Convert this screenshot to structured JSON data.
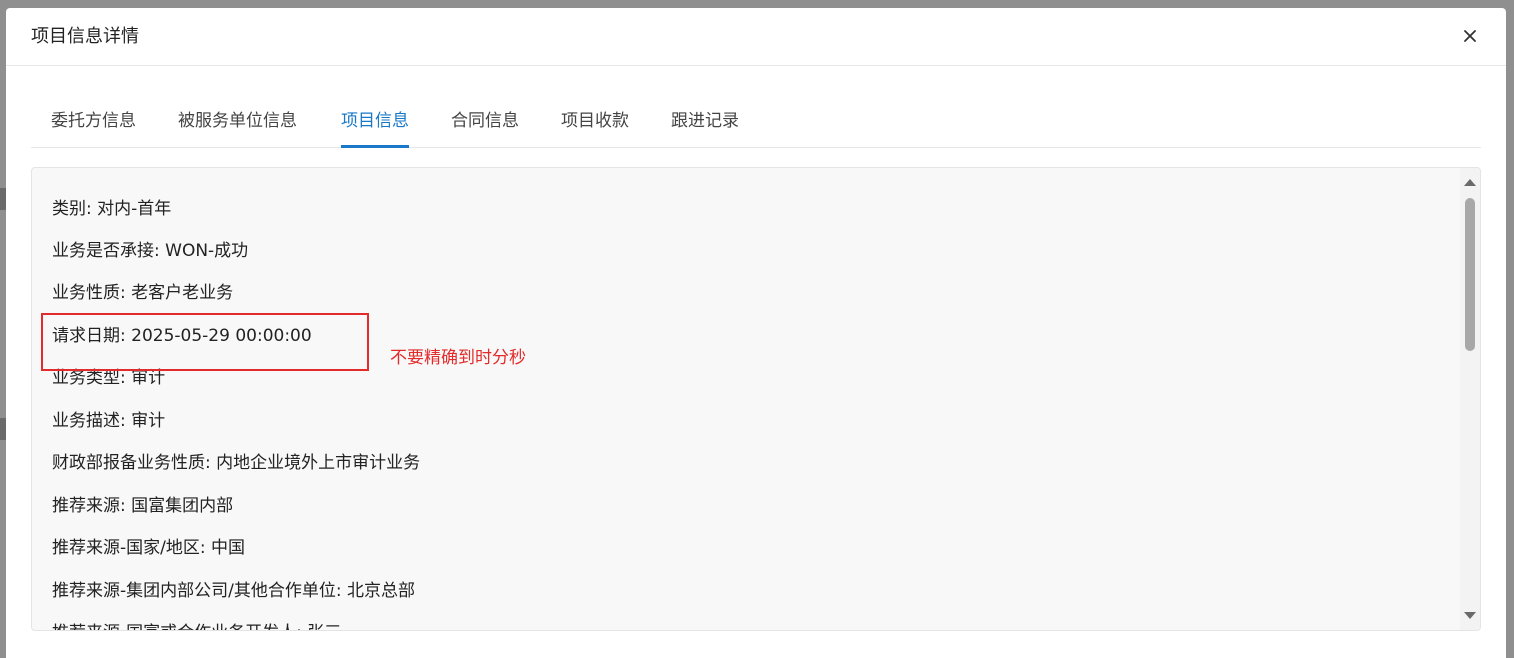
{
  "modal": {
    "title": "项目信息详情",
    "close_label": "×"
  },
  "tabs": [
    {
      "label": "委托方信息",
      "active": false
    },
    {
      "label": "被服务单位信息",
      "active": false
    },
    {
      "label": "项目信息",
      "active": true
    },
    {
      "label": "合同信息",
      "active": false
    },
    {
      "label": "项目收款",
      "active": false
    },
    {
      "label": "跟进记录",
      "active": false
    }
  ],
  "fields": [
    {
      "text": "类别: 对内-首年"
    },
    {
      "text": "业务是否承接: WON-成功"
    },
    {
      "text": "业务性质: 老客户老业务"
    },
    {
      "text": "请求日期: 2025-05-29 00:00:00"
    },
    {
      "text": "业务类型: 审计"
    },
    {
      "text": "业务描述: 审计"
    },
    {
      "text": "财政部报备业务性质: 内地企业境外上市审计业务"
    },
    {
      "text": "推荐来源: 国富集团内部"
    },
    {
      "text": "推荐来源-国家/地区: 中国"
    },
    {
      "text": "推荐来源-集团内部公司/其他合作单位: 北京总部"
    },
    {
      "text": "推荐来源-国富或合作业务开发人: 张三"
    }
  ],
  "annotation": {
    "text": "不要精确到时分秒",
    "color": "#e32b2b"
  },
  "colors": {
    "accent": "#1a78c9",
    "annotation_red": "#e32b2b"
  }
}
